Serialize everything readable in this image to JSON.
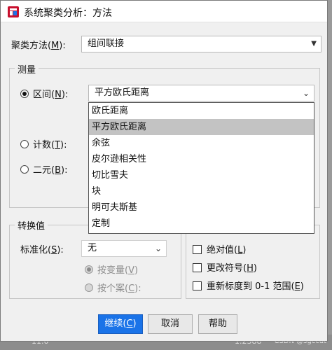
{
  "dialog": {
    "title": "系统聚类分析：方法"
  },
  "cluster_method": {
    "label_prefix": "聚类方法(",
    "label_key": "M",
    "label_suffix": "):",
    "value": "组间联接"
  },
  "measure": {
    "title": "测量",
    "interval": {
      "label_prefix": "区间(",
      "label_key": "N",
      "label_suffix": "):",
      "value": "平方欧氏距离"
    },
    "count": {
      "label_prefix": "计数(",
      "label_key": "T",
      "label_suffix": "):"
    },
    "binary": {
      "label_prefix": "二元(",
      "label_key": "B",
      "label_suffix": "):"
    },
    "dropdown_options": [
      "欧氏距离",
      "平方欧氏距离",
      "余弦",
      "皮尔逊相关性",
      "切比雪夫",
      "块",
      "明可夫斯基",
      "定制"
    ],
    "selected_option": "平方欧氏距离"
  },
  "transform_values": {
    "title": "转换值",
    "standardize": {
      "label_prefix": "标准化(",
      "label_key": "S",
      "label_suffix": "):",
      "value": "无"
    },
    "by_variable": {
      "label_prefix": "按变量(",
      "label_key": "V",
      "label_suffix": ")"
    },
    "by_case": {
      "label_prefix": "按个案(",
      "label_key": "C",
      "label_suffix": "):"
    }
  },
  "transform_measures": {
    "absolute": {
      "label_prefix": "绝对值(",
      "label_key": "L",
      "label_suffix": ")"
    },
    "change_sign": {
      "label_prefix": "更改符号(",
      "label_key": "H",
      "label_suffix": ")"
    },
    "rescale": {
      "label_prefix": "重新标度到 0-1 范围(",
      "label_key": "E",
      "label_suffix": ")"
    }
  },
  "buttons": {
    "continue_prefix": "继续(",
    "continue_key": "C",
    "continue_suffix": ")",
    "cancel": "取消",
    "help": "帮助"
  },
  "background": {
    "left_value": "11.0",
    "right_value": "1.2388",
    "watermark": "CSDN @sgccdt"
  },
  "colors": {
    "primary_button": "#1a73e8",
    "selected_item": "#c3c3c3"
  }
}
